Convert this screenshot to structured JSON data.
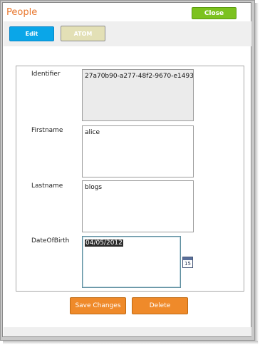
{
  "dialog": {
    "title": "People"
  },
  "header": {
    "close_label": "Close"
  },
  "toolbar": {
    "edit_label": "Edit",
    "atom_label": "ATOM"
  },
  "form": {
    "identifier": {
      "label": "Identifier",
      "value": "27a70b90-a277-48f2-9670-e1493"
    },
    "firstname": {
      "label": "Firstname",
      "value": "alice"
    },
    "lastname": {
      "label": "Lastname",
      "value": "blogs"
    },
    "dateofbirth": {
      "label": "DateOfBirth",
      "value": "04/05/2012",
      "calendar_day": "15"
    }
  },
  "actions": {
    "save_label": "Save Changes",
    "delete_label": "Delete"
  },
  "colors": {
    "title": "#e8762c",
    "close_button": "#7cc21f",
    "edit_button": "#0aa6e8",
    "atom_button": "#e3e0b6",
    "action_button": "#ef8a2a"
  },
  "icons": {
    "calendar": "calendar-icon"
  }
}
